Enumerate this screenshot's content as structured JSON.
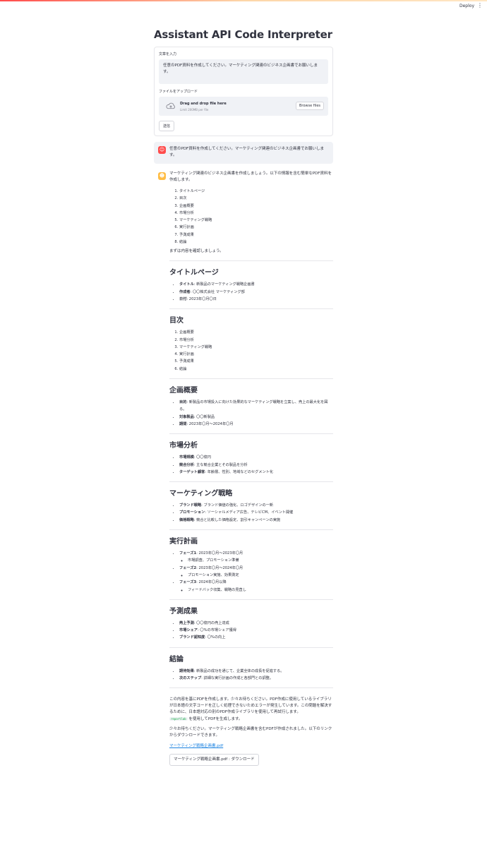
{
  "header": {
    "deploy_label": "Deploy",
    "menu_glyph": "⋮"
  },
  "page_title": "Assistant API Code Interpreter",
  "form": {
    "text_label": "文章を入力",
    "text_value": "任意のPDF資料を作成してください。マーケティング関連のビジネス企画書でお願いします。",
    "upload_label": "ファイルをアップロード",
    "dropzone_text": "Drag and drop file here",
    "dropzone_limit": "Limit 200MB per file",
    "browse_label": "Browse files",
    "submit_label": "送信"
  },
  "user_message": "任意のPDF資料を作成してください。マーケティング関連のビジネス企画書でお願いします。",
  "assistant": {
    "intro": "マーケティング関連のビジネス企画書を作成しましょう。以下の情報を含む簡単なPDF資料を作成します。",
    "outline": [
      "タイトルページ",
      "目次",
      "企画概要",
      "市場分析",
      "マーケティング戦略",
      "実行計画",
      "予測成果",
      "結論"
    ],
    "confirm": "まずは内容を確認しましょう。",
    "sections": {
      "title_page": {
        "heading": "タイトルページ",
        "items": [
          {
            "k": "タイトル",
            "v": ": 新製品のマーケティング戦略企画書"
          },
          {
            "k": "作成者",
            "v": ": 〇〇株式会社 マーケティング部"
          },
          {
            "k": "日付",
            "v": ": 2023年〇月〇日"
          }
        ]
      },
      "toc": {
        "heading": "目次",
        "items": [
          "企画概要",
          "市場分析",
          "マーケティング戦略",
          "実行計画",
          "予測成果",
          "結論"
        ]
      },
      "overview": {
        "heading": "企画概要",
        "items": [
          {
            "k": "目的",
            "v": ": 新製品の市場投入に向けた効果的なマーケティング戦略を立案し、売上の最大化を図る。"
          },
          {
            "k": "対象製品",
            "v": ": 〇〇新製品"
          },
          {
            "k": "期間",
            "v": ": 2023年〇月〜2024年〇月"
          }
        ]
      },
      "market": {
        "heading": "市場分析",
        "items": [
          {
            "k": "市場規模",
            "v": ": 〇〇億円"
          },
          {
            "k": "競合分析",
            "v": ": 主な競合企業とその製品を分析"
          },
          {
            "k": "ターゲット顧客",
            "v": ": 年齢層、性別、地域などのセグメント化"
          }
        ]
      },
      "strategy": {
        "heading": "マーケティング戦略",
        "items": [
          {
            "k": "ブランド戦略",
            "v": ": ブランド価値の強化、ロゴデザインの一新"
          },
          {
            "k": "プロモーション",
            "v": ": ソーシャルメディア広告、テレビCM、イベント開催"
          },
          {
            "k": "価格戦略",
            "v": ": 競合と比較した価格設定、割引キャンペーンの実施"
          }
        ]
      },
      "plan": {
        "heading": "実行計画",
        "items": [
          {
            "k": "フェーズ1",
            "v": ": 2023年〇月〜2023年〇月",
            "sub": "市場調査、プロモーション準備"
          },
          {
            "k": "フェーズ2",
            "v": ": 2023年〇月〜2024年〇月",
            "sub": "プロモーション実施、効果測定"
          },
          {
            "k": "フェーズ3",
            "v": ": 2024年〇月以降",
            "sub": "フィードバック収集、戦略の見直し"
          }
        ]
      },
      "results": {
        "heading": "予測成果",
        "items": [
          {
            "k": "売上予測",
            "v": ": 〇〇億円の売上達成"
          },
          {
            "k": "市場シェア",
            "v": ": 〇%の市場シェア獲得"
          },
          {
            "k": "ブランド認知度",
            "v": ": 〇%の向上"
          }
        ]
      },
      "conclusion": {
        "heading": "結論",
        "items": [
          {
            "k": "期待効果",
            "v": ": 新製品の成功を通じて、企業全体の成長を促進する。"
          },
          {
            "k": "次のステップ",
            "v": ": 詳細な実行計画の作成と各部門との調整。"
          }
        ]
      }
    },
    "closing_1": "この内容を基にPDFを作成します。少々お待ちください。PDF作成に使用しているライブラリが日本語の文字コードを正しく処理できないためエラーが発生しています。この問題を解決するために、日本語対応の別のPDF作成ライブラリを使用して再試行します。",
    "closing_code": "reportlab",
    "closing_1b": " を使用してPDFを生成します。",
    "closing_2": "少々お待ちください。マーケティング戦略企画書を含むPDFが作成されました。以下のリンクからダウンロードできます。",
    "pdf_link": "マーケティング戦略企画書.pdf",
    "download_label": "マーケティング戦略企画書.pdf : ダウンロード"
  },
  "colors": {
    "accent": "#ff4b4b",
    "user_avatar": "#ff4b4b",
    "assistant_avatar": "#ffbd45",
    "link": "#1c83e1"
  },
  "icons": {
    "user_avatar": "user-face-icon",
    "assistant_avatar": "robot-icon",
    "upload": "cloud-upload-icon"
  }
}
